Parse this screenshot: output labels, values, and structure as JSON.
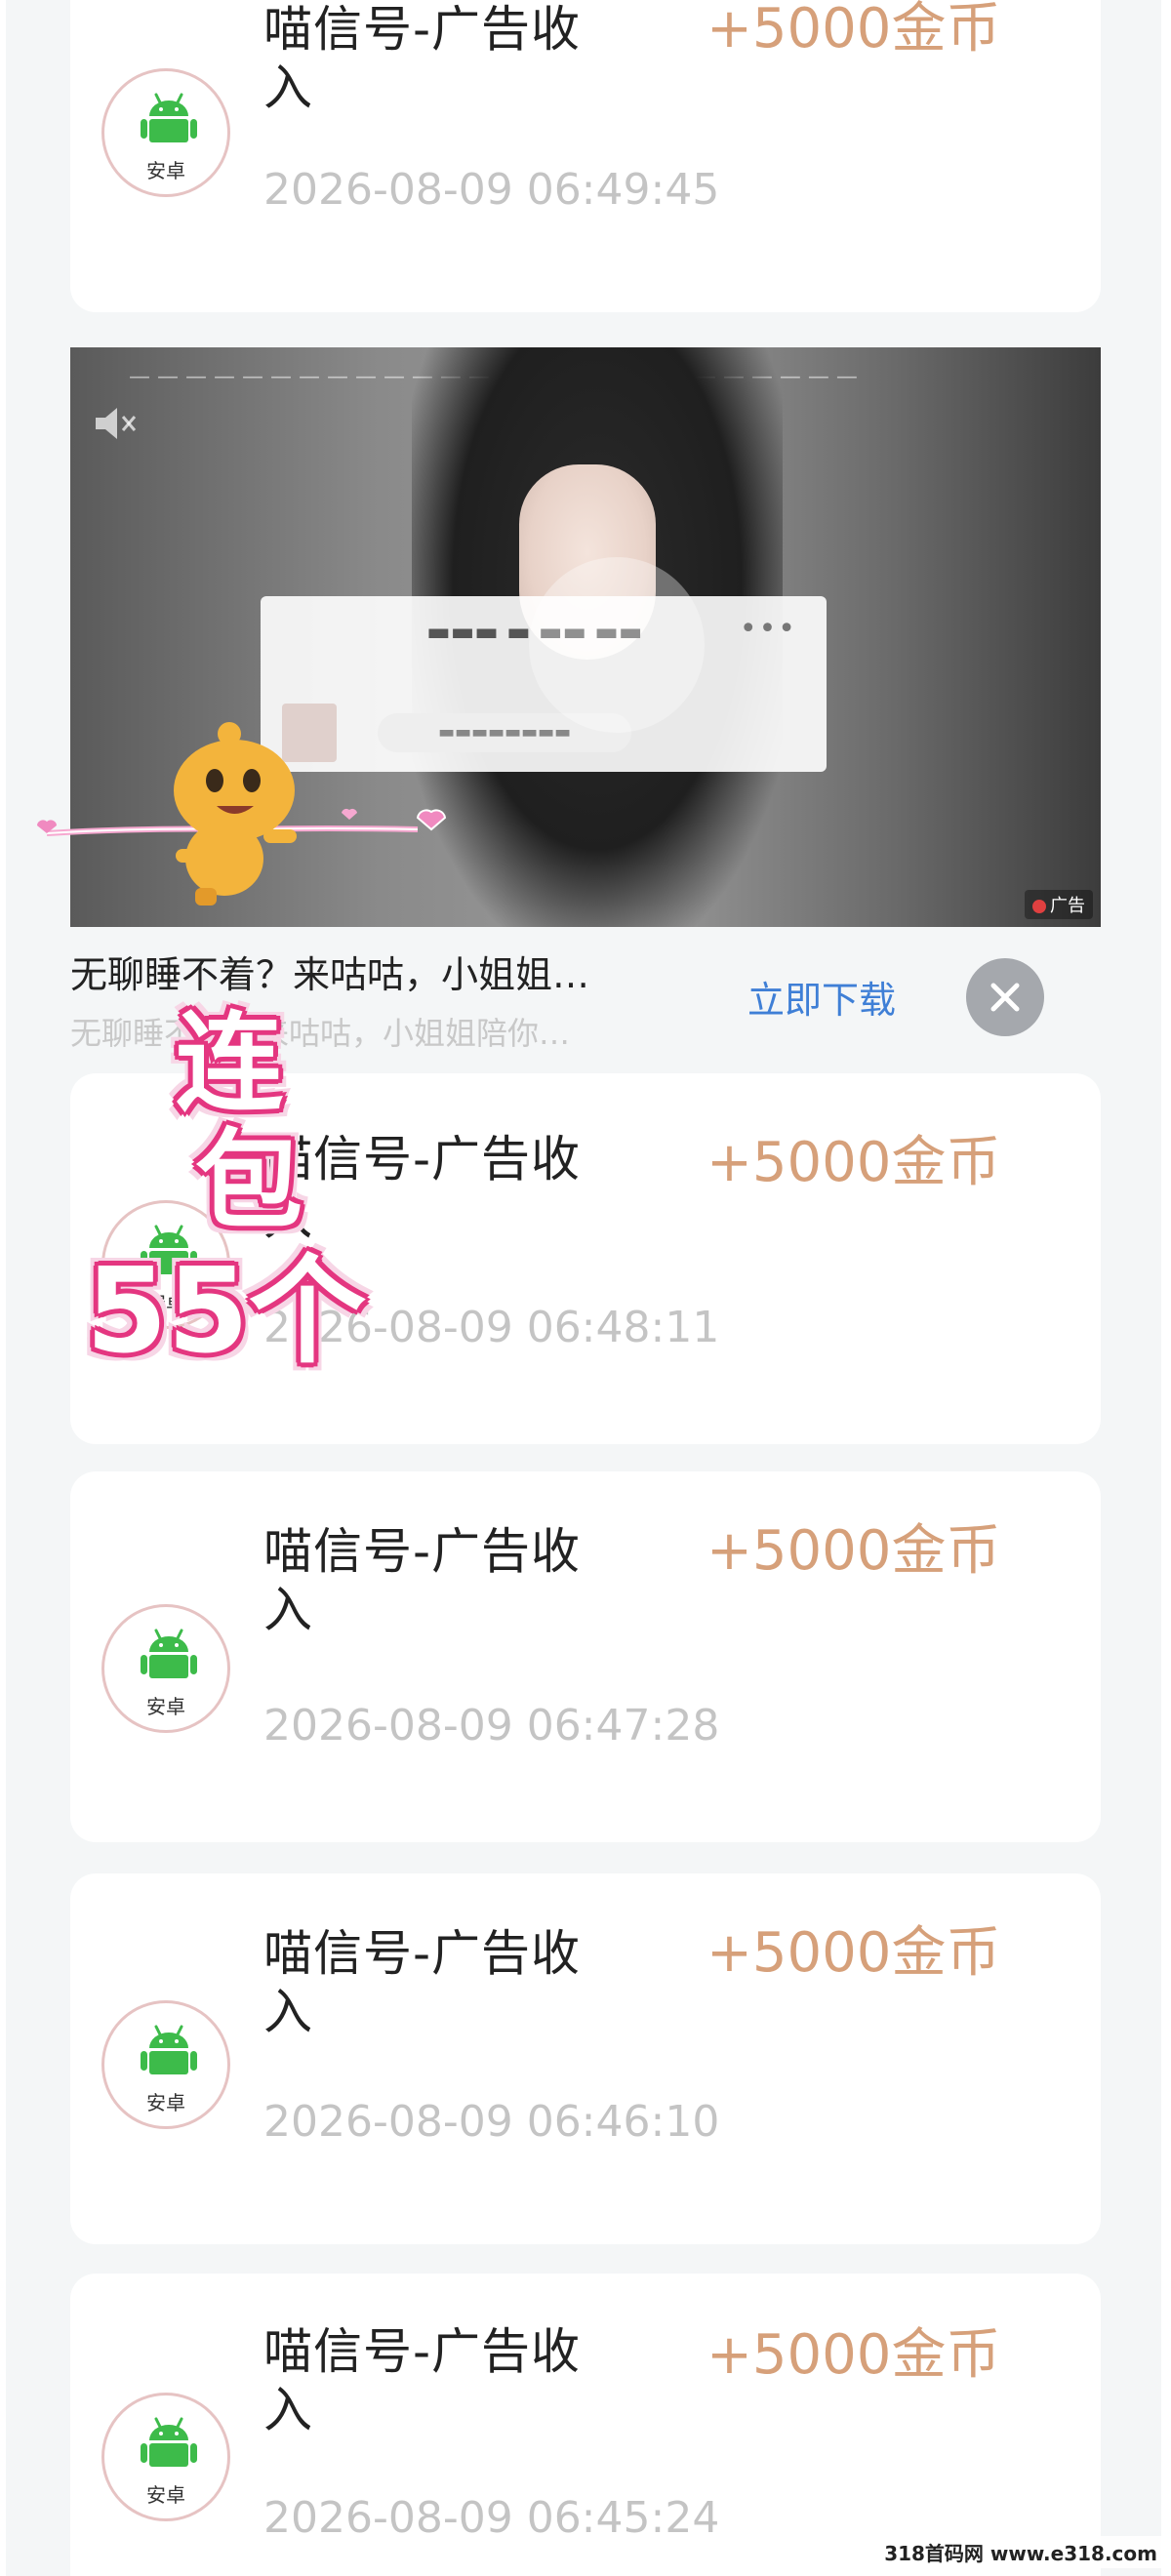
{
  "records": [
    {
      "title": "喵信号-广告收入",
      "amount": "+5000金币",
      "time": "2026-08-09 06:49:45",
      "platform": "安卓"
    },
    {
      "title": "喵信号-广告收入",
      "amount": "+5000金币",
      "time": "2026-08-09 06:48:11",
      "platform": "安卓"
    },
    {
      "title": "喵信号-广告收入",
      "amount": "+5000金币",
      "time": "2026-08-09 06:47:28",
      "platform": "安卓"
    },
    {
      "title": "喵信号-广告收入",
      "amount": "+5000金币",
      "time": "2026-08-09 06:46:10",
      "platform": "安卓"
    },
    {
      "title": "喵信号-广告收入",
      "amount": "+5000金币",
      "time": "2026-08-09 06:45:24",
      "platform": "安卓"
    }
  ],
  "ad": {
    "title": "无聊睡不着？来咕咕，小姐姐…",
    "description": "无聊睡不着？来咕咕，小姐姐陪你…",
    "download_label": "立即下载",
    "corner_label": "广告"
  },
  "overlay": {
    "line1": "连",
    "line2": "包",
    "line3": "55个"
  },
  "watermark": "318首码网 www.e318.com",
  "colors": {
    "amount": "#d6a07a",
    "android": "#3dbb4a",
    "download": "#3f7fd6",
    "sticker": "#e43680"
  },
  "icons": {
    "platform": "android-icon",
    "close": "close-icon"
  }
}
